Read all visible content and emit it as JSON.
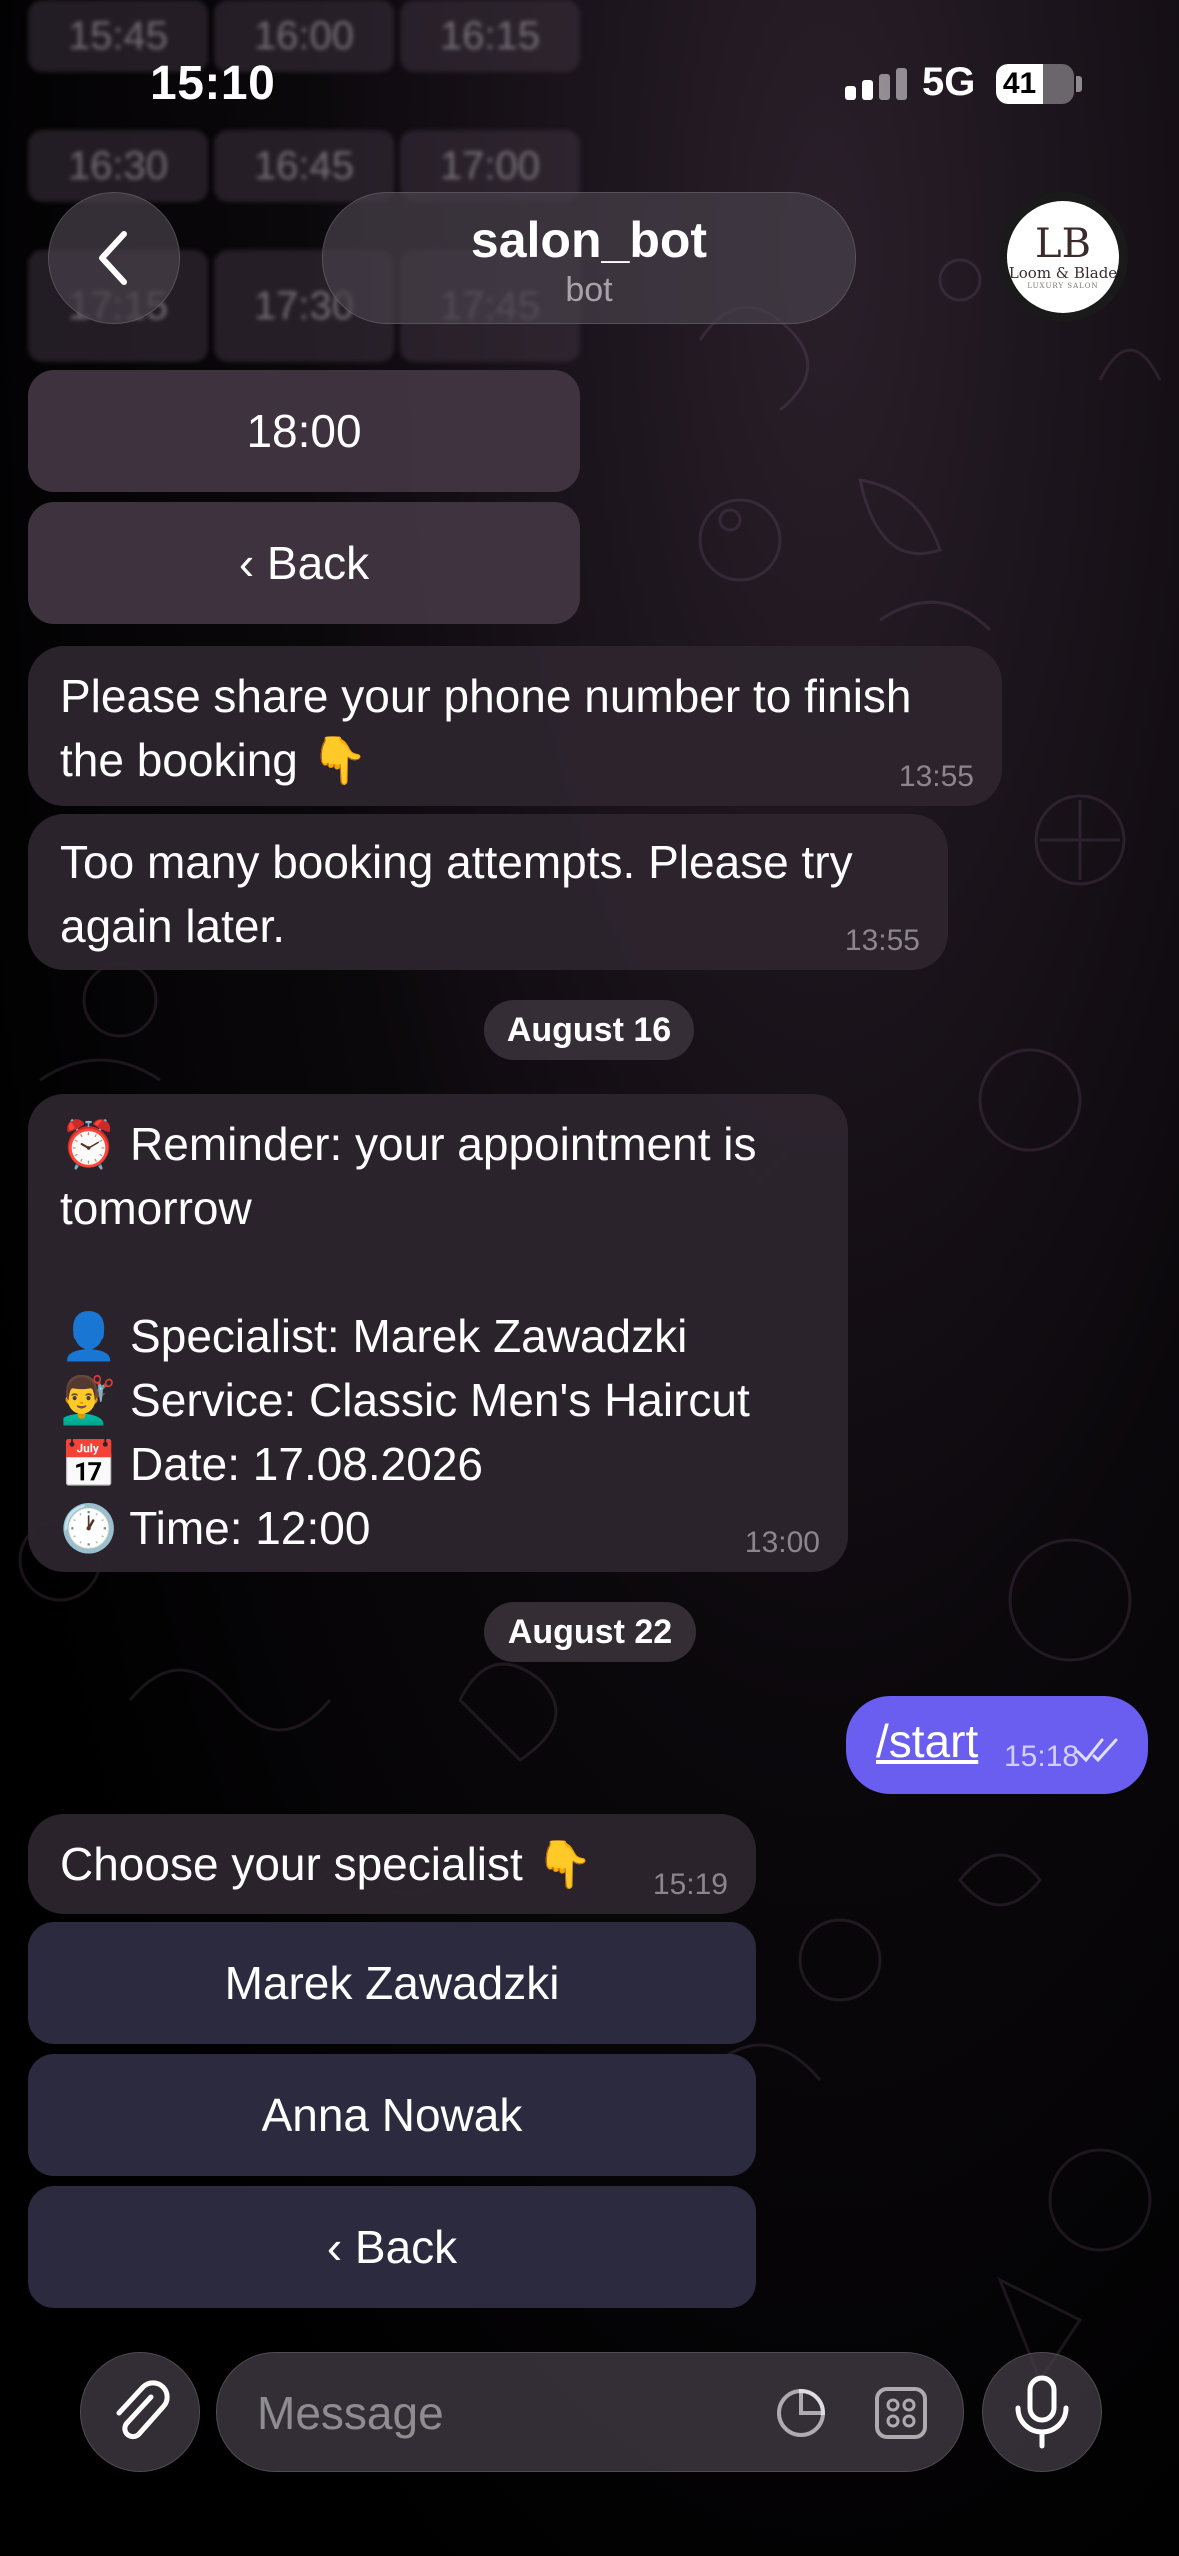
{
  "status": {
    "time": "15:10",
    "network": "5G",
    "battery": "41"
  },
  "header": {
    "title": "salon_bot",
    "subtitle": "bot",
    "avatar": {
      "monogram": "LB",
      "brand": "Loom & Blade",
      "tagline": "LUXURY SALON"
    }
  },
  "ghost_times": [
    "15:45",
    "16:00",
    "16:15",
    "16:30",
    "16:45",
    "17:00",
    "17:15",
    "17:30",
    "17:45"
  ],
  "top_buttons": {
    "time_slot": "18:00",
    "back": "‹ Back"
  },
  "messages": [
    {
      "text": "Please share your phone number to finish the booking 👇",
      "line1": "Please share your phone number to finish",
      "line2": "the booking 👇",
      "time": "13:55"
    },
    {
      "text": "Too many booking attempts. Please try again later.",
      "line1": "Too many booking attempts. Please try",
      "line2": "again later.",
      "time": "13:55"
    }
  ],
  "date_aug16": "August 16",
  "reminder": {
    "line1": "⏰ Reminder: your appointment is",
    "line2": "tomorrow",
    "specialist": "👤 Specialist: Marek Zawadzki",
    "service": "💇‍♂️ Service: Classic Men's Haircut",
    "date": "📅 Date: 17.08.2026",
    "time_line": "🕐 Time: 12:00",
    "time": "13:00"
  },
  "date_aug22": "August 22",
  "outgoing": {
    "text": "/start",
    "time": "15:18"
  },
  "choose": {
    "text": "Choose your specialist 👇",
    "time": "15:19"
  },
  "specialists": [
    "Marek Zawadzki",
    "Anna Nowak",
    "‹ Back"
  ],
  "composer": {
    "placeholder": "Message"
  },
  "colors": {
    "outgoing": "#6a5ef0",
    "incoming": "#2d242e",
    "background": "#000000"
  }
}
